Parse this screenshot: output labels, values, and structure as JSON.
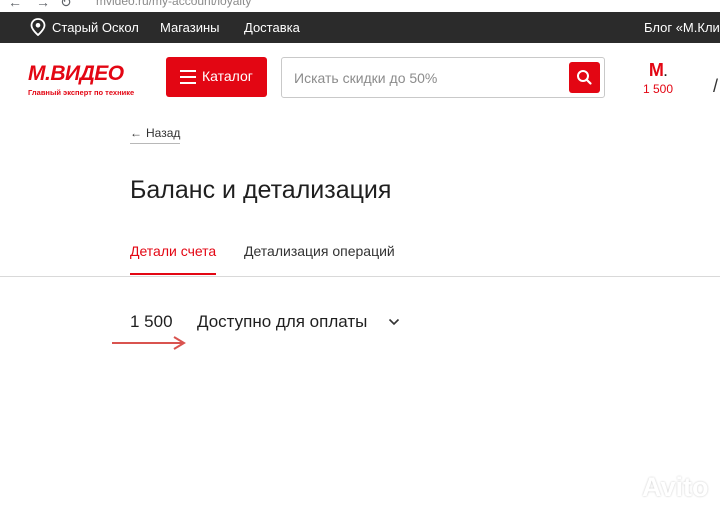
{
  "browser": {
    "url": "mvideo.ru/my-account/loyalty"
  },
  "topbar": {
    "city": "Старый Оскол",
    "stores": "Магазины",
    "delivery": "Доставка",
    "blog": "Блог «М.Клик"
  },
  "header": {
    "logo_text": "М.ВИДЕО",
    "logo_tagline": "Главный эксперт по технике",
    "catalog_label": "Каталог",
    "search_placeholder": "Искать скидки до 50%",
    "bonus_brand": "M",
    "bonus_value": "1 500"
  },
  "content": {
    "back_label": "Назад",
    "title": "Баланс и детализация",
    "tabs": [
      {
        "label": "Детали счета",
        "active": true
      },
      {
        "label": "Детализация операций",
        "active": false
      }
    ],
    "balance_value": "1 500",
    "balance_label": "Доступно для оплаты"
  },
  "watermark": {
    "text": "Avito"
  },
  "colors": {
    "accent": "#e30613",
    "topbar": "#2b2b2b",
    "arrow": "#d9534f"
  }
}
